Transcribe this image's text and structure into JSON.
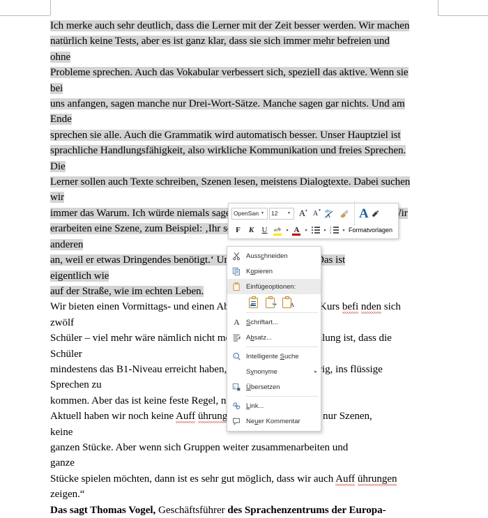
{
  "document": {
    "lines": [
      {
        "text": "Ich merke auch sehr deutlich, dass die Lerner mit der Zeit besser werden. Wir machen",
        "selected": true
      },
      {
        "text": "natürlich keine Tests, aber es ist ganz klar, dass sie sich immer mehr befreien und",
        "selected": true
      },
      {
        "text": "ohne",
        "selected": true
      },
      {
        "text": "Probleme sprechen. Auch das Vokabular verbessert sich, speziell das aktive. Wenn sie",
        "selected": true
      },
      {
        "text": "bei",
        "selected": true
      },
      {
        "text": "uns anfangen, sagen manche nur Drei-Wort-Sätze. Manche sagen gar nichts. Und am",
        "selected": true
      },
      {
        "text": "Ende",
        "selected": true
      },
      {
        "text": "sprechen sie alle. Auch die Grammatik wird automatisch besser. Unser Hauptziel ist",
        "selected": true
      },
      {
        "text": "sprachliche Handlungsfähigkeit, also wirkliche Kommunikation und freies Sprechen.",
        "selected": true
      },
      {
        "text": "Die",
        "selected": true
      },
      {
        "text": "Lerner sollen auch Texte schreiben, Szenen lesen, meistens Dialogtexte. Dabei suchen",
        "selected": true
      },
      {
        "text": "wir",
        "selected": true
      },
      {
        "text": "immer das Warum. Ich würde niemals sagen: Wir üben jetzt ein Telefongespräch. Wir",
        "selected": true
      },
      {
        "text": "erarbeiten eine Szene, zum Beispiel: ‚Ihr seid zwei Freunde und der eine ruft den",
        "selected": true
      },
      {
        "text": "anderen",
        "selected": true
      },
      {
        "text": "an, weil er etwas Dringendes benötigt.‘ Und dann sprechen sie. Das ist",
        "selected": true
      },
      {
        "text": "eigentlich wie",
        "selected": true
      },
      {
        "text": "auf der Straße, wie im echten Leben.",
        "selected": true
      },
      {
        "text": "Wir bieten einen Vormittags- und einen Abendkurs an. In jedem Kurs befi nden sich",
        "selected": false
      },
      {
        "text": "zwölf",
        "selected": false
      },
      {
        "text": "Schüler – viel mehr wäre nämlich nicht möglich. Unsere Empfehlung ist, dass die",
        "selected": false
      },
      {
        "text": "Schüler",
        "selected": false
      },
      {
        "text": "mindestens das B1-Niveau erreicht haben, sonst ist es zu schwierig, ins flüssige",
        "selected": false
      },
      {
        "text": "Sprechen zu",
        "selected": false
      },
      {
        "text": "kommen. Aber das ist keine feste Regel, nur eine Orientierung.",
        "selected": false
      },
      {
        "text": "Aktuell haben wir noch keine Auff ührungen. Die Lerner spielen nur Szenen,",
        "selected": false
      },
      {
        "text": "keine",
        "selected": false
      },
      {
        "text": "ganzen Stücke. Aber wenn sich Gruppen weiter zusammenarbeiten und",
        "selected": false
      },
      {
        "text": "ganze",
        "selected": false
      },
      {
        "text": "Stücke spielen möchten, dann ist es sehr gut möglich, dass wir auch Auff ührungen",
        "selected": false
      },
      {
        "text": "zeigen.“",
        "selected": false
      }
    ],
    "last_line": {
      "bold_1": "Das sagt Thomas Vogel,",
      "normal_1": " Geschäftsführer ",
      "bold_2": "des Sprachenzentrums der Europa-"
    },
    "misspelled_words": [
      "befi",
      "nden",
      "Auff",
      "ührungen"
    ]
  },
  "mini_toolbar": {
    "font_name": "OpenSan:",
    "font_size": "12",
    "buttons": [
      {
        "name": "grow-font",
        "label": "A"
      },
      {
        "name": "shrink-font",
        "label": "A"
      },
      {
        "name": "change-case",
        "label": "abc\\nA"
      },
      {
        "name": "format-painter",
        "label": "brush"
      },
      {
        "name": "bold",
        "label": "F"
      },
      {
        "name": "italic",
        "label": "K"
      },
      {
        "name": "underline",
        "label": "U"
      },
      {
        "name": "text-highlight",
        "label": "ab"
      },
      {
        "name": "font-color",
        "label": "A"
      },
      {
        "name": "bullets",
        "label": "list"
      },
      {
        "name": "numbering",
        "label": "numlist"
      }
    ],
    "styles_label": "Formatvorlagen"
  },
  "context_menu": {
    "items": [
      {
        "id": "cut",
        "label": "Ausschneiden",
        "icon": "scissors-icon",
        "has_submenu": false,
        "is_header": false
      },
      {
        "id": "copy",
        "label": "Kopieren",
        "icon": "copy-icon",
        "has_submenu": false,
        "is_header": false
      },
      {
        "id": "paste-opts",
        "label": "Einfügeoptionen:",
        "icon": "clipboard-icon",
        "has_submenu": false,
        "is_header": true
      },
      {
        "id": "font",
        "label": "Schriftart...",
        "icon": "font-icon",
        "has_submenu": false,
        "is_header": false
      },
      {
        "id": "paragraph",
        "label": "Absatz...",
        "icon": "paragraph-icon",
        "has_submenu": false,
        "is_header": false
      },
      {
        "id": "smart-lookup",
        "label": "Intelligente Suche",
        "icon": "magnifier-icon",
        "has_submenu": false,
        "is_header": false
      },
      {
        "id": "synonyms",
        "label": "Synonyme",
        "icon": "none",
        "has_submenu": true,
        "is_header": false
      },
      {
        "id": "translate",
        "label": "Übersetzen",
        "icon": "translate-icon",
        "has_submenu": false,
        "is_header": false
      },
      {
        "id": "link",
        "label": "Link...",
        "icon": "link-icon",
        "has_submenu": false,
        "is_header": false
      },
      {
        "id": "comment",
        "label": "Neuer Kommentar",
        "icon": "comment-icon",
        "has_submenu": false,
        "is_header": false
      }
    ],
    "paste_options": [
      {
        "id": "paste-keep-source",
        "name": "paste-keep-source-formatting-icon"
      },
      {
        "id": "paste-merge",
        "name": "paste-merge-formatting-icon"
      },
      {
        "id": "paste-text-only",
        "name": "paste-text-only-icon"
      }
    ],
    "submenu_arrow": "▸"
  },
  "colors": {
    "selection": "#d4d4d4",
    "spellcheck": "#d23a2e",
    "accent": "#1f5fa9",
    "highlight_yellow": "#ffe600",
    "font_color_red": "#c00000",
    "menu_header_bg": "#ebebeb"
  }
}
